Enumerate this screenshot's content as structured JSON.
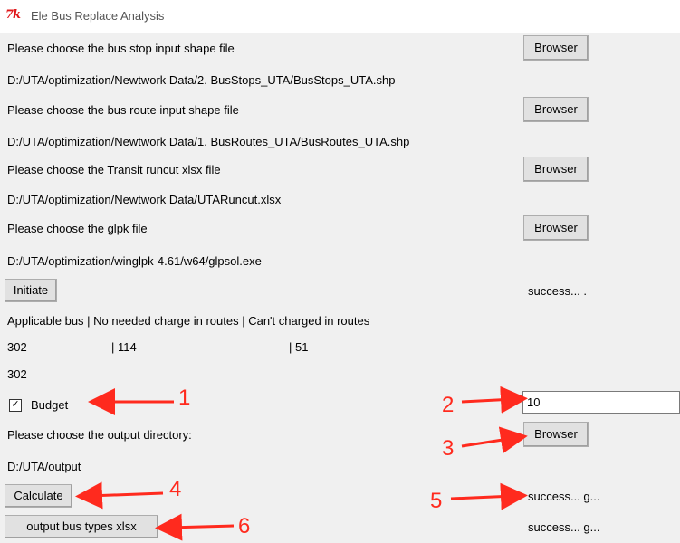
{
  "window": {
    "icon_text": "7k",
    "title": "Ele Bus Replace Analysis"
  },
  "rows": {
    "stop_label": "Please choose the bus stop input shape file",
    "stop_path": "D:/UTA/optimization/Newtwork Data/2. BusStops_UTA/BusStops_UTA.shp",
    "route_label": "Please choose the bus route input shape file",
    "route_path": "D:/UTA/optimization/Newtwork Data/1. BusRoutes_UTA/BusRoutes_UTA.shp",
    "runcut_label": "Please choose the Transit runcut xlsx file",
    "runcut_path": "D:/UTA/optimization/Newtwork Data/UTARuncut.xlsx",
    "glpk_label": "Please choose the glpk file",
    "glpk_path": "D:/UTA/optimization/winglpk-4.61/w64/glpsol.exe",
    "output_label": "Please choose the output directory:",
    "output_path": "D:/UTA/output"
  },
  "buttons": {
    "browser": "Browser",
    "initiate": "Initiate",
    "calculate": "Calculate",
    "output_xlsx": "output bus types xlsx"
  },
  "status": {
    "initiate": "success... .",
    "calculate": "success... g...",
    "output": "success... g..."
  },
  "summary": {
    "header": "Applicable bus | No needed charge in routes | Can't charged in routes",
    "applicable": "302",
    "no_charge": "| 114",
    "cant_charge": "| 51",
    "total": "302"
  },
  "budget": {
    "label": "Budget",
    "checked_mark": "✓",
    "value": "10"
  },
  "annotations": {
    "n1": "1",
    "n2": "2",
    "n3": "3",
    "n4": "4",
    "n5": "5",
    "n6": "6",
    "color": "#ff2a1e"
  }
}
